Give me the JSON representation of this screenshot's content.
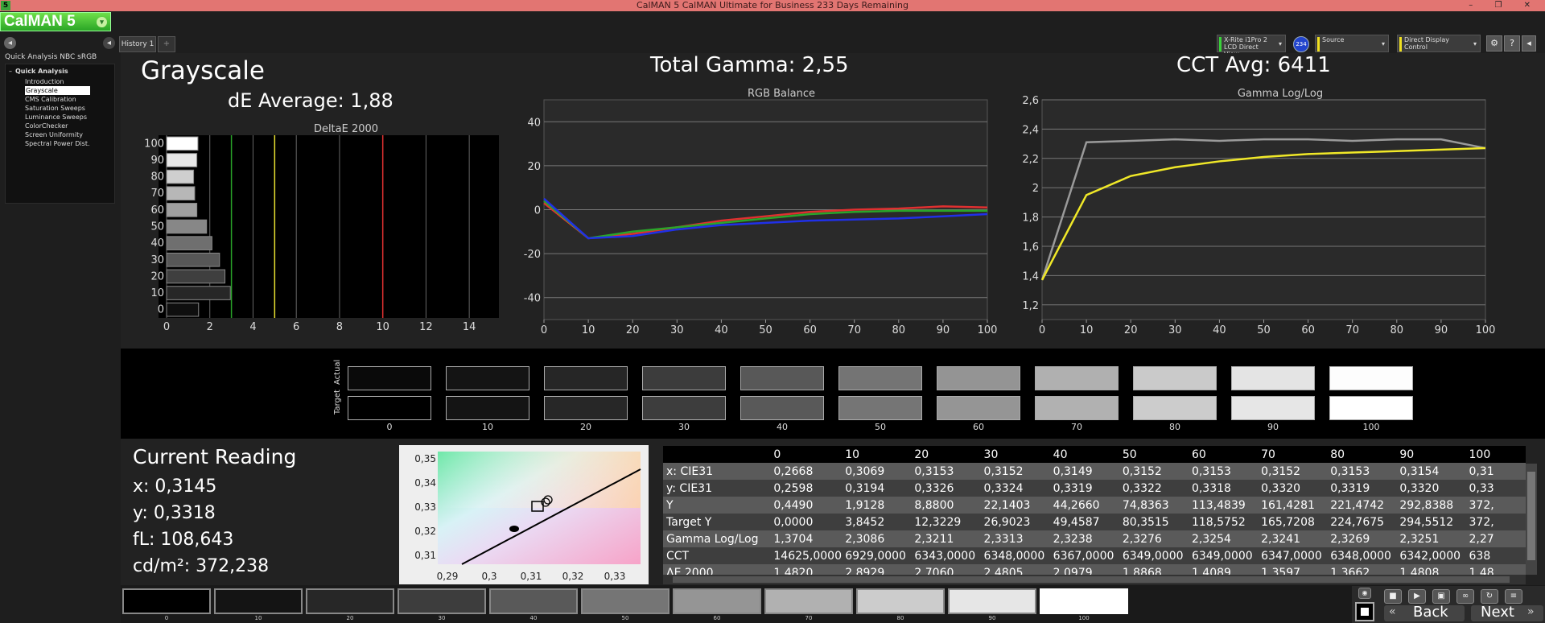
{
  "window": {
    "title": "CalMAN 5 CalMAN Ultimate for Business 233 Days Remaining",
    "icon_label": "5",
    "controls": "– ❐ ✕"
  },
  "logo": {
    "text": "CalMAN 5"
  },
  "topbar": {
    "history_tab": "History 1",
    "history_add": "+"
  },
  "devices": [
    {
      "line1": "X-Rite i1Pro 2",
      "line2": "LCD Direct View",
      "badge": "234",
      "stripe": "#3ad13a"
    },
    {
      "line1": "Source",
      "line2": "",
      "stripe": "#f0e020"
    },
    {
      "line1": "Direct Display Control",
      "line2": "",
      "stripe": "#f0e020"
    }
  ],
  "sidebar": {
    "workflow": "Quick Analysis NBC sRGB",
    "root": "Quick Analysis",
    "items": [
      "Introduction",
      "Grayscale",
      "CMS Calibration",
      "Saturation Sweeps",
      "Luminance Sweeps",
      "ColorChecker",
      "Screen Uniformity",
      "Spectral Power Dist."
    ],
    "selected": 1
  },
  "header": {
    "title": "Grayscale",
    "de_avg": "dE Average: 1,88",
    "gamma": "Total Gamma: 2,55",
    "cct": "CCT Avg: 6411"
  },
  "deltae": {
    "title": "DeltaE 2000",
    "categories": [
      "100",
      "90",
      "80",
      "70",
      "60",
      "50",
      "40",
      "30",
      "20",
      "10",
      "0"
    ],
    "values": [
      1.45,
      1.4,
      1.25,
      1.3,
      1.4,
      1.85,
      2.1,
      2.45,
      2.7,
      2.95,
      1.48
    ],
    "xticks": [
      "0",
      "2",
      "4",
      "6",
      "8",
      "10",
      "12",
      "14"
    ],
    "xlim": [
      0,
      15
    ],
    "lines": [
      {
        "x": 3,
        "color": "#29a329"
      },
      {
        "x": 5,
        "color": "#e8e030"
      },
      {
        "x": 10,
        "color": "#e03030"
      }
    ]
  },
  "chart_data": [
    {
      "type": "line",
      "title": "RGB Balance",
      "x": [
        0,
        10,
        20,
        30,
        40,
        50,
        60,
        70,
        80,
        90,
        100
      ],
      "xlim": [
        0,
        100
      ],
      "ylim": [
        -50,
        50
      ],
      "xticks": [
        "0",
        "10",
        "20",
        "30",
        "40",
        "50",
        "60",
        "70",
        "80",
        "90",
        "100"
      ],
      "yticks": [
        "40",
        "20",
        "0",
        "-20",
        "-40"
      ],
      "series": [
        {
          "color": "#e03030",
          "values": [
            3,
            -13,
            -11,
            -8,
            -5,
            -3,
            -1,
            0,
            0.5,
            1.5,
            1
          ]
        },
        {
          "color": "#2aa52a",
          "values": [
            4,
            -13,
            -10,
            -8,
            -6,
            -4,
            -2,
            -1,
            -0.5,
            -0.5,
            -0.5
          ]
        },
        {
          "color": "#2030e8",
          "values": [
            5,
            -13,
            -12,
            -9,
            -7,
            -6,
            -5,
            -4.5,
            -4,
            -3,
            -2
          ]
        }
      ]
    },
    {
      "type": "line",
      "title": "Gamma Log/Log",
      "x": [
        0,
        10,
        20,
        30,
        40,
        50,
        60,
        70,
        80,
        90,
        100
      ],
      "xlim": [
        0,
        100
      ],
      "ylim": [
        1.1,
        2.6
      ],
      "xticks": [
        "0",
        "10",
        "20",
        "30",
        "40",
        "50",
        "60",
        "70",
        "80",
        "90",
        "100"
      ],
      "yticks": [
        "2,6",
        "2,4",
        "2,2",
        "2",
        "1,8",
        "1,6",
        "1,4",
        "1,2"
      ],
      "series": [
        {
          "color": "#9a9a9a",
          "values": [
            1.37,
            2.31,
            2.32,
            2.33,
            2.32,
            2.33,
            2.33,
            2.32,
            2.33,
            2.33,
            2.27
          ]
        },
        {
          "color": "#f0e828",
          "values": [
            1.37,
            1.95,
            2.08,
            2.14,
            2.18,
            2.21,
            2.23,
            2.24,
            2.25,
            2.26,
            2.27
          ]
        }
      ]
    }
  ],
  "swatches": {
    "labels": [
      "0",
      "10",
      "20",
      "30",
      "40",
      "50",
      "60",
      "70",
      "80",
      "90",
      "100"
    ],
    "actual": [
      "#0a0a0a",
      "#141414",
      "#262626",
      "#3c3c3c",
      "#585858",
      "#747474",
      "#949494",
      "#b0b0b0",
      "#cacaca",
      "#e4e4e4",
      "#fdfdfd"
    ],
    "target": [
      "#000000",
      "#141414",
      "#272727",
      "#3d3d3d",
      "#595959",
      "#757575",
      "#959595",
      "#b1b1b1",
      "#cccccc",
      "#e6e6e6",
      "#ffffff"
    ],
    "row_actual": "Actual",
    "row_target": "Target"
  },
  "current_reading": {
    "title": "Current Reading",
    "x": "x: 0,3145",
    "y": "y: 0,3318",
    "fl": "fL: 108,643",
    "cdm2": "cd/m²: 372,238"
  },
  "cie": {
    "xticks": [
      "0,29",
      "0,3",
      "0,31",
      "0,32",
      "0,33"
    ],
    "yticks": [
      "0,35",
      "0,34",
      "0,33",
      "0,32",
      "0,31"
    ]
  },
  "table": {
    "columns": [
      "0",
      "10",
      "20",
      "30",
      "40",
      "50",
      "60",
      "70",
      "80",
      "90",
      "100"
    ],
    "rows": [
      {
        "label": "x: CIE31",
        "values": [
          "0,2668",
          "0,3069",
          "0,3153",
          "0,3152",
          "0,3149",
          "0,3152",
          "0,3153",
          "0,3152",
          "0,3153",
          "0,3154",
          "0,31"
        ]
      },
      {
        "label": "y: CIE31",
        "values": [
          "0,2598",
          "0,3194",
          "0,3326",
          "0,3324",
          "0,3319",
          "0,3322",
          "0,3318",
          "0,3320",
          "0,3319",
          "0,3320",
          "0,33"
        ]
      },
      {
        "label": "Y",
        "values": [
          "0,4490",
          "1,9128",
          "8,8800",
          "22,1403",
          "44,2660",
          "74,8363",
          "113,4839",
          "161,4281",
          "221,4742",
          "292,8388",
          "372,"
        ]
      },
      {
        "label": "Target Y",
        "values": [
          "0,0000",
          "3,8452",
          "12,3229",
          "26,9023",
          "49,4587",
          "80,3515",
          "118,5752",
          "165,7208",
          "224,7675",
          "294,5512",
          "372,"
        ]
      },
      {
        "label": "Gamma Log/Log",
        "values": [
          "1,3704",
          "2,3086",
          "2,3211",
          "2,3313",
          "2,3238",
          "2,3276",
          "2,3254",
          "2,3241",
          "2,3269",
          "2,3251",
          "2,27"
        ]
      },
      {
        "label": "CCT",
        "values": [
          "14625,0000",
          "6929,0000",
          "6343,0000",
          "6348,0000",
          "6367,0000",
          "6349,0000",
          "6349,0000",
          "6347,0000",
          "6348,0000",
          "6342,0000",
          "638"
        ]
      },
      {
        "label": "ΔE 2000",
        "values": [
          "1,4820",
          "2,8929",
          "2,7060",
          "2,4805",
          "2,0979",
          "1,8868",
          "1,4089",
          "1,3597",
          "1,3662",
          "1,4808",
          "1,48"
        ]
      }
    ]
  },
  "bottom": {
    "labels": [
      "0",
      "10",
      "20",
      "30",
      "40",
      "50",
      "60",
      "70",
      "80",
      "90",
      "100"
    ],
    "colors": [
      "#000000",
      "#141414",
      "#272727",
      "#3d3d3d",
      "#595959",
      "#757575",
      "#959595",
      "#b1b1b1",
      "#cccccc",
      "#e6e6e6",
      "#ffffff"
    ]
  },
  "nav": {
    "back": "Back",
    "next": "Next"
  }
}
